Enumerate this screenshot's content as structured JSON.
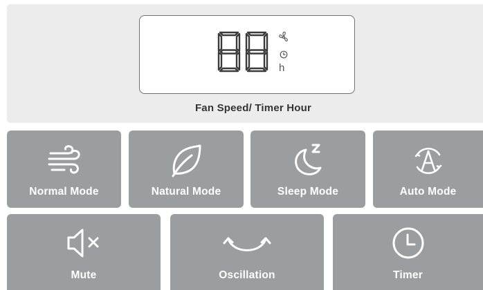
{
  "display": {
    "digits": "88",
    "unit": "h",
    "indicators": [
      "fan-icon",
      "clock-icon"
    ],
    "caption": "Fan Speed/ Timer Hour"
  },
  "buttons": {
    "normal_mode": {
      "label": "Normal Mode",
      "icon": "wind-icon"
    },
    "natural_mode": {
      "label": "Natural Mode",
      "icon": "leaf-icon"
    },
    "sleep_mode": {
      "label": "Sleep Mode",
      "icon": "moon-icon"
    },
    "auto_mode": {
      "label": "Auto Mode",
      "icon": "auto-a-icon"
    },
    "mute": {
      "label": "Mute",
      "icon": "speaker-mute-icon"
    },
    "oscillation": {
      "label": "Oscillation",
      "icon": "oscillation-icon"
    },
    "timer": {
      "label": "Timer",
      "icon": "clock-icon"
    }
  },
  "colors": {
    "button_bg": "#9b9ea1",
    "panel_bg": "#ececec",
    "display_digits": "#3a3a3a"
  }
}
